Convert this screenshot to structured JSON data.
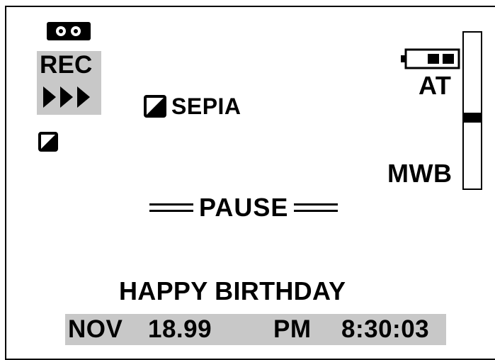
{
  "icons": {
    "tape": "tape-cassette-icon",
    "fast_forward": "triple-play-arrow-icon",
    "picture_effect": "diagonal-split-square-icon",
    "battery": "battery-icon",
    "pause_bars": "double-line-icon"
  },
  "recording": {
    "mode": "REC"
  },
  "effect": {
    "label": "SEPIA"
  },
  "white_balance": {
    "auto_label": "AT",
    "manual_label": "MWB",
    "level_percent": 55
  },
  "status": {
    "pause": "PAUSE"
  },
  "title": {
    "text": "HAPPY BIRTHDAY"
  },
  "datetime": {
    "month": "NOV",
    "date": "18.99",
    "ampm": "PM",
    "time": "8:30:03"
  },
  "colors": {
    "foreground": "#000000",
    "background": "#ffffff",
    "highlight_gray": "#c8c8c8"
  }
}
